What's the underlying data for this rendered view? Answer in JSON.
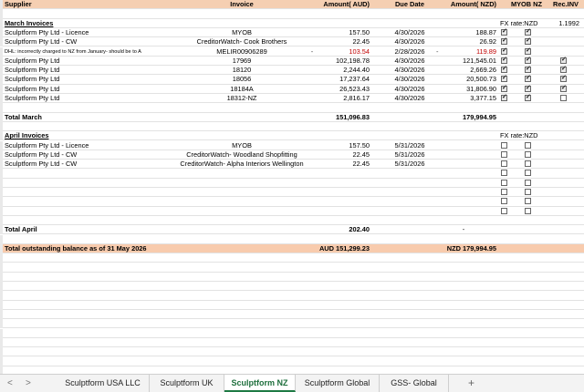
{
  "headers": {
    "supplier": "Supplier",
    "invoice": "Invoice",
    "amount_aud": "Amount( AUD)",
    "due_date": "Due Date",
    "amount_nzd": "Amount( NZD)",
    "myob_nz": "MYOB NZ",
    "rec_inv": "Rec.INV"
  },
  "march": {
    "title": "March Invoices",
    "fx_label": "FX rate:NZD",
    "fx_value": "1.1992",
    "rows": [
      {
        "supplier": "Sculptform Pty Ltd - Licence",
        "invoice": "MYOB",
        "aud": "157.50",
        "due": "4/30/2026",
        "nzd": "188.87",
        "myob": true,
        "rec": null
      },
      {
        "supplier": "Sculptform Pty Ltd - CW",
        "invoice": "CreditorWatch- Cook Brothers",
        "aud": "22.45",
        "due": "4/30/2026",
        "nzd": "26.92",
        "myob": true,
        "rec": null
      },
      {
        "supplier": "DHL: incorrectly charged to NZ from January- should be to A",
        "invoice": "MELIR00906289",
        "aud": "103.54",
        "due": "2/28/2026",
        "nzd": "119.89",
        "myob": true,
        "rec": null,
        "red": true,
        "dash": "-",
        "dash2": "-"
      },
      {
        "supplier": "Sculptform Pty Ltd",
        "invoice": "17969",
        "aud": "102,198.78",
        "due": "4/30/2026",
        "nzd": "121,545.01",
        "myob": true,
        "rec": true
      },
      {
        "supplier": "Sculptform Pty Ltd",
        "invoice": "18120",
        "aud": "2,244.40",
        "due": "4/30/2026",
        "nzd": "2,669.26",
        "myob": true,
        "rec": true
      },
      {
        "supplier": "Sculptform Pty Ltd",
        "invoice": "18056",
        "aud": "17,237.64",
        "due": "4/30/2026",
        "nzd": "20,500.73",
        "myob": true,
        "rec": true
      },
      {
        "supplier": "Sculptform Pty Ltd",
        "invoice": "18184A",
        "aud": "26,523.43",
        "due": "4/30/2026",
        "nzd": "31,806.90",
        "myob": true,
        "rec": true
      },
      {
        "supplier": "Sculptform Pty Ltd",
        "invoice": "18312-NZ",
        "aud": "2,816.17",
        "due": "4/30/2026",
        "nzd": "3,377.15",
        "myob": true,
        "rec": false
      }
    ],
    "total_label": "Total March",
    "total_aud": "151,096.83",
    "total_nzd": "179,994.95"
  },
  "april": {
    "title": "April Invoices",
    "fx_label": "FX rate:NZD",
    "rows": [
      {
        "supplier": "Sculptform Pty Ltd - Licence",
        "invoice": "MYOB",
        "aud": "157.50",
        "due": "5/31/2026",
        "myob": false
      },
      {
        "supplier": "Sculptform Pty Ltd - CW",
        "invoice": "CreditorWatch- Woodland Shopfitting",
        "aud": "22.45",
        "due": "5/31/2026",
        "myob": false
      },
      {
        "supplier": "Sculptform Pty Ltd - CW",
        "invoice": "CreditorWatch- Alpha Interiors Wellington",
        "aud": "22.45",
        "due": "5/31/2026",
        "myob": false
      }
    ],
    "total_label": "Total April",
    "total_aud": "202.40",
    "total_nzd": "-"
  },
  "outstanding": {
    "label": "Total outstanding balance as of 31 May 2026",
    "aud": "AUD 151,299.23",
    "nzd": "NZD 179,994.95"
  },
  "tabs": {
    "nav_prev": "<",
    "nav_next": ">",
    "items": [
      "Sculptform USA LLC",
      "Sculptform UK",
      "Sculptform NZ",
      "Sculptform Global",
      "GSS- Global"
    ],
    "active_index": 2,
    "add": "+"
  }
}
